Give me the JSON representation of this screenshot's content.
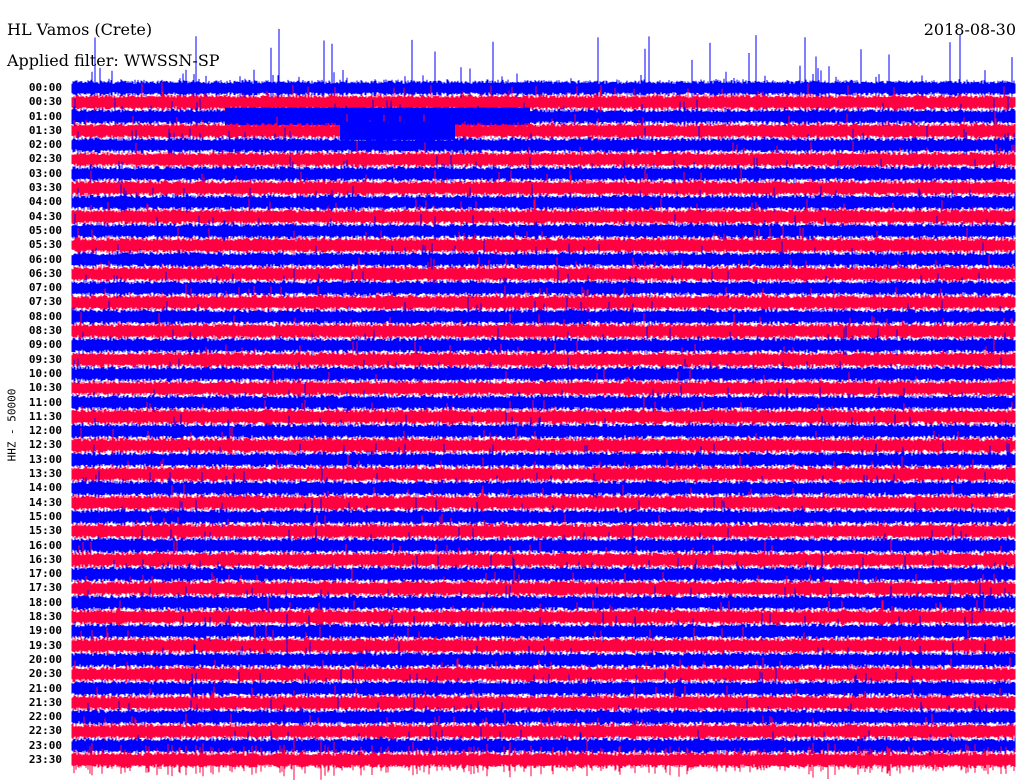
{
  "header": {
    "station": "HL Vamos (Crete)",
    "date": "2018-08-30",
    "filter": "Applied filter: WWSSN-SP"
  },
  "chart_data": {
    "type": "line",
    "title": "HL Vamos (Crete)",
    "ylabel": "HHZ - 50000",
    "row_labels": [
      "00:00",
      "00:30",
      "01:00",
      "01:30",
      "02:00",
      "02:30",
      "03:00",
      "03:30",
      "04:00",
      "04:30",
      "05:00",
      "05:30",
      "06:00",
      "06:30",
      "07:00",
      "07:30",
      "08:00",
      "08:30",
      "09:00",
      "09:30",
      "10:00",
      "10:30",
      "11:00",
      "11:30",
      "12:00",
      "12:30",
      "13:00",
      "13:30",
      "14:00",
      "14:30",
      "15:00",
      "15:30",
      "16:00",
      "16:30",
      "17:00",
      "17:30",
      "18:00",
      "18:30",
      "19:00",
      "19:30",
      "20:00",
      "20:30",
      "21:00",
      "21:30",
      "22:00",
      "22:30",
      "23:00",
      "23:30"
    ],
    "minutes_per_row": 30,
    "colors": [
      "#0000ff",
      "#ff0040"
    ]
  }
}
